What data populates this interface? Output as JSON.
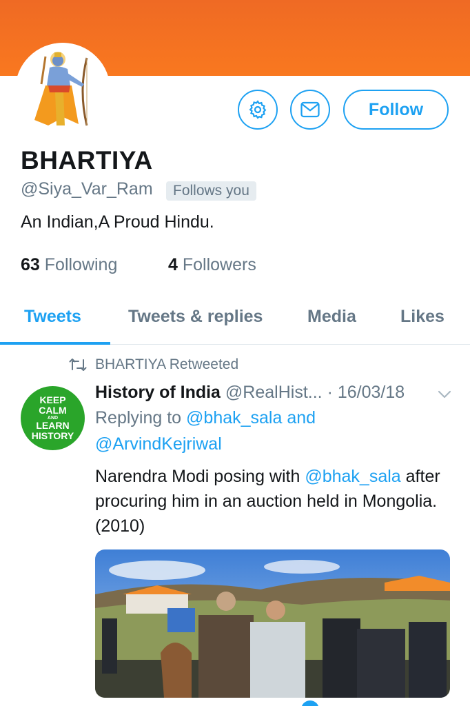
{
  "colors": {
    "banner": "#f26b21",
    "accent": "#1da1f2",
    "muted": "#657786",
    "text": "#14171a",
    "avatar_green": "#2aa52a"
  },
  "profile": {
    "display_name": "BHARTIYA",
    "handle": "@Siya_Var_Ram",
    "follows_you": "Follows you",
    "bio": "An Indian,A Proud Hindu.",
    "following_count": "63",
    "following_label": "Following",
    "followers_count": "4",
    "followers_label": "Followers"
  },
  "actions": {
    "settings_icon": "gear-icon",
    "message_icon": "envelope-icon",
    "follow_label": "Follow"
  },
  "tabs": [
    {
      "label": "Tweets",
      "active": true
    },
    {
      "label": "Tweets & replies",
      "active": false
    },
    {
      "label": "Media",
      "active": false
    },
    {
      "label": "Likes",
      "active": false
    }
  ],
  "tweet": {
    "retweeted_by": "BHARTIYA Retweeted",
    "avatar_text": [
      "KEEP",
      "CALM",
      "AND",
      "LEARN",
      "HISTORY"
    ],
    "author_name": "History of India",
    "author_handle": "@RealHist...",
    "date": "· 16/03/18",
    "replying_prefix": "Replying to",
    "replying_user1": "@bhak_sala",
    "replying_and": "and",
    "replying_user2": "@ArvindKejriwal",
    "text_part1": "Narendra Modi posing with",
    "text_mention": "@bhak_sala",
    "text_part2": "after procuring him in an auction held in Mongolia.(2010)"
  }
}
